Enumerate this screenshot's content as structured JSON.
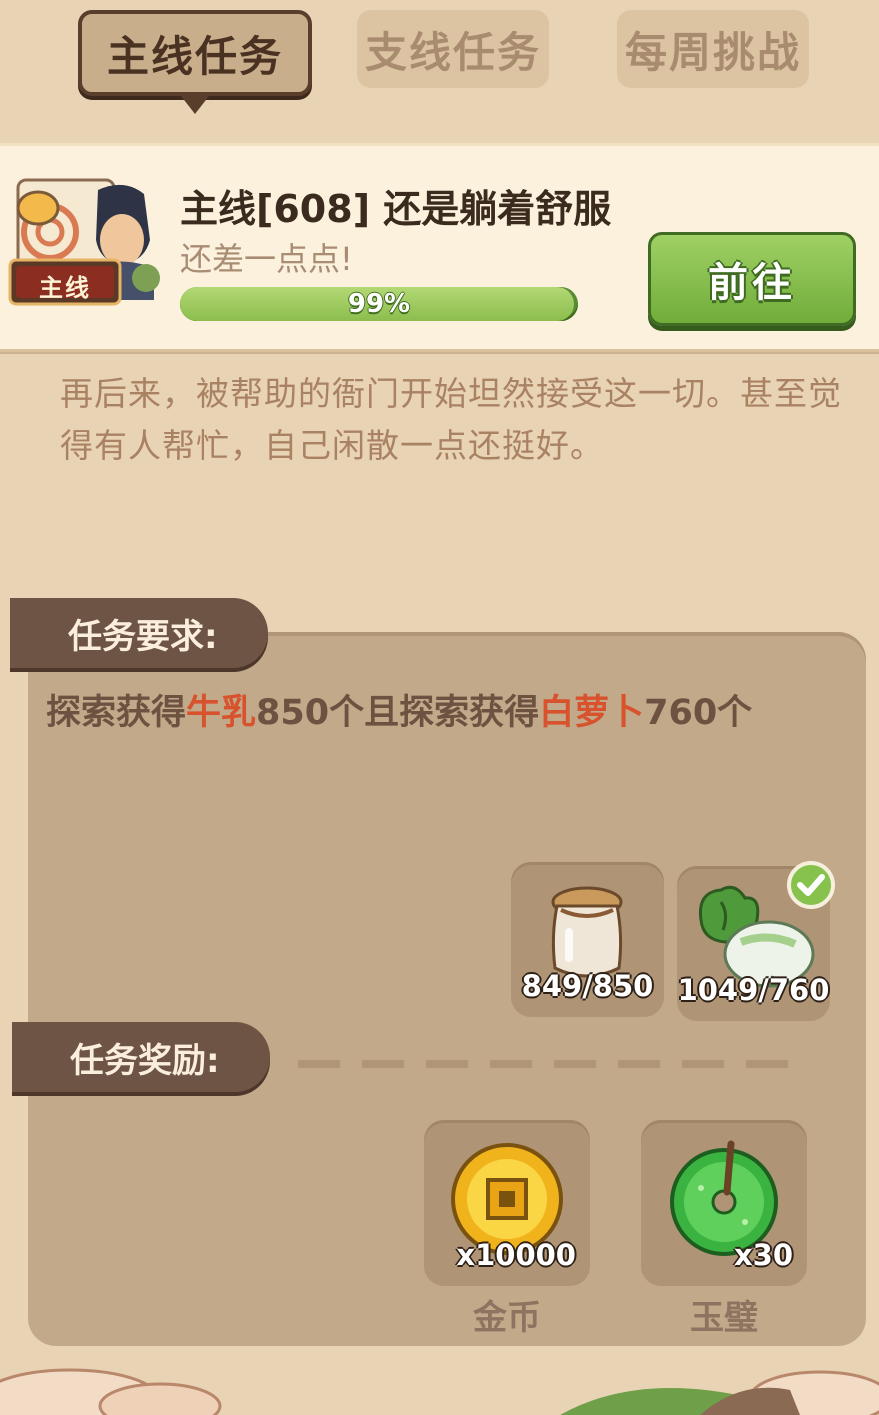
{
  "tabs": [
    {
      "label": "主线任务",
      "active": true
    },
    {
      "label": "支线任务",
      "active": false
    },
    {
      "label": "每周挑战",
      "active": false
    }
  ],
  "quest": {
    "badge": "主线",
    "title": "主线[608] 还是躺着舒服",
    "subtitle": "还差一点点!",
    "progress_percent": 99,
    "progress_label": "99%",
    "go_button": "前往"
  },
  "story": "再后来，被帮助的衙门开始坦然接受这一切。甚至觉得有人帮忙，自己闲散一点还挺好。",
  "requirements": {
    "header": "任务要求:",
    "text_parts": {
      "p1": "探索获得",
      "item1": "牛乳",
      "p2": "850个且探索获得",
      "item2": "白萝卜",
      "p3": "760个"
    },
    "items": [
      {
        "icon": "milk-jar-icon",
        "count": "849/850",
        "completed": false
      },
      {
        "icon": "white-radish-icon",
        "count": "1049/760",
        "completed": true
      }
    ]
  },
  "rewards": {
    "header": "任务奖励:",
    "items": [
      {
        "icon": "gold-coin-icon",
        "count": "x10000",
        "name": "金币"
      },
      {
        "icon": "jade-bi-icon",
        "count": "x30",
        "name": "玉璧"
      }
    ]
  },
  "colors": {
    "highlight": "#d8532d",
    "progress_green": "#8cbd4e",
    "button_green": "#71ad3b",
    "ribbon_brown": "#6d5444"
  }
}
